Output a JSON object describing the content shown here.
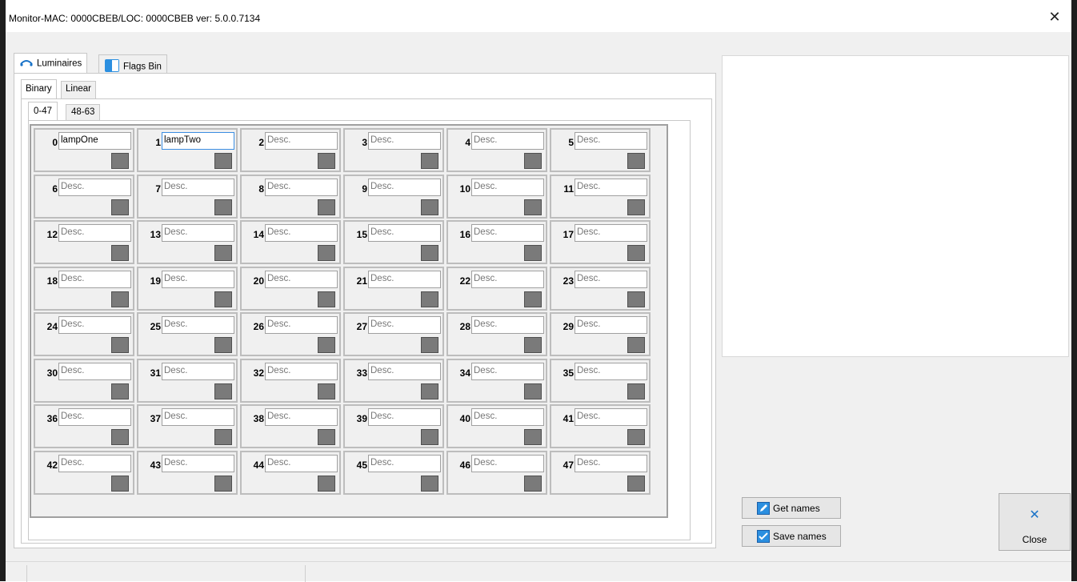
{
  "window": {
    "title": "Monitor-MAC: 0000CBEB/LOC: 0000CBEB ver: 5.0.0.7134",
    "close_glyph": "✕"
  },
  "outer_tabs": [
    {
      "label": "Luminaires",
      "icon": "luminaires-icon",
      "active": true
    },
    {
      "label": "Flags Bin",
      "icon": "flags-bin-icon",
      "active": false
    }
  ],
  "inner_tabs": [
    {
      "label": "Binary",
      "active": true
    },
    {
      "label": "Linear",
      "active": false
    }
  ],
  "range_tabs": [
    {
      "label": "0-47",
      "active": true
    },
    {
      "label": "48-63",
      "active": false
    }
  ],
  "placeholder": "Desc.",
  "cells": [
    {
      "num": "0",
      "value": "lampOne"
    },
    {
      "num": "1",
      "value": "lampTwo",
      "focused": true
    },
    {
      "num": "2",
      "value": ""
    },
    {
      "num": "3",
      "value": ""
    },
    {
      "num": "4",
      "value": ""
    },
    {
      "num": "5",
      "value": ""
    },
    {
      "num": "6",
      "value": ""
    },
    {
      "num": "7",
      "value": ""
    },
    {
      "num": "8",
      "value": ""
    },
    {
      "num": "9",
      "value": ""
    },
    {
      "num": "10",
      "value": ""
    },
    {
      "num": "11",
      "value": ""
    },
    {
      "num": "12",
      "value": ""
    },
    {
      "num": "13",
      "value": ""
    },
    {
      "num": "14",
      "value": ""
    },
    {
      "num": "15",
      "value": ""
    },
    {
      "num": "16",
      "value": ""
    },
    {
      "num": "17",
      "value": ""
    },
    {
      "num": "18",
      "value": ""
    },
    {
      "num": "19",
      "value": ""
    },
    {
      "num": "20",
      "value": ""
    },
    {
      "num": "21",
      "value": ""
    },
    {
      "num": "22",
      "value": ""
    },
    {
      "num": "23",
      "value": ""
    },
    {
      "num": "24",
      "value": ""
    },
    {
      "num": "25",
      "value": ""
    },
    {
      "num": "26",
      "value": ""
    },
    {
      "num": "27",
      "value": ""
    },
    {
      "num": "28",
      "value": ""
    },
    {
      "num": "29",
      "value": ""
    },
    {
      "num": "30",
      "value": ""
    },
    {
      "num": "31",
      "value": ""
    },
    {
      "num": "32",
      "value": ""
    },
    {
      "num": "33",
      "value": ""
    },
    {
      "num": "34",
      "value": ""
    },
    {
      "num": "35",
      "value": ""
    },
    {
      "num": "36",
      "value": ""
    },
    {
      "num": "37",
      "value": ""
    },
    {
      "num": "38",
      "value": ""
    },
    {
      "num": "39",
      "value": ""
    },
    {
      "num": "40",
      "value": ""
    },
    {
      "num": "41",
      "value": ""
    },
    {
      "num": "42",
      "value": ""
    },
    {
      "num": "43",
      "value": ""
    },
    {
      "num": "44",
      "value": ""
    },
    {
      "num": "45",
      "value": ""
    },
    {
      "num": "46",
      "value": ""
    },
    {
      "num": "47",
      "value": ""
    }
  ],
  "buttons": {
    "get_names": "Get names",
    "save_names": "Save names",
    "close": "Close"
  },
  "colors": {
    "state_off": "#7a7a7a",
    "focus_border": "#3c8ee2",
    "accent": "#1a73c8"
  }
}
